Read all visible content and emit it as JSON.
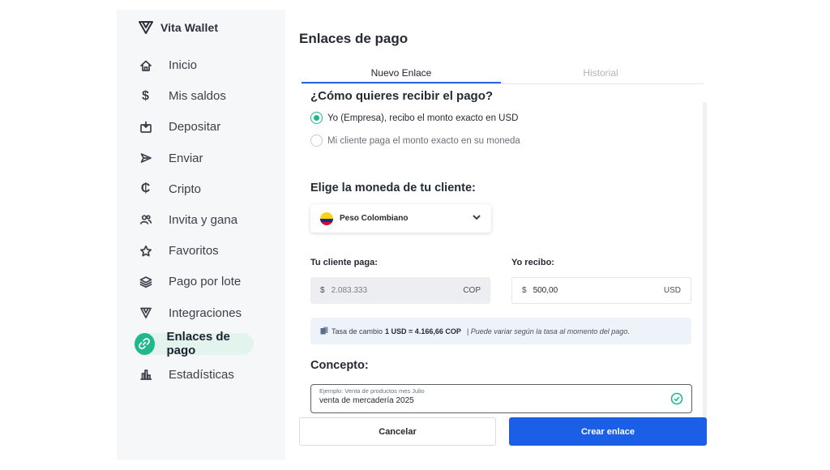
{
  "brand": {
    "name": "Vita Wallet"
  },
  "sidebar": {
    "items": [
      {
        "label": "Inicio",
        "icon": "home-icon"
      },
      {
        "label": "Mis saldos",
        "icon": "dollar-icon"
      },
      {
        "label": "Depositar",
        "icon": "deposit-icon"
      },
      {
        "label": "Enviar",
        "icon": "send-icon"
      },
      {
        "label": "Cripto",
        "icon": "crypto-icon"
      },
      {
        "label": "Invita y gana",
        "icon": "invite-icon"
      },
      {
        "label": "Favoritos",
        "icon": "star-icon"
      },
      {
        "label": "Pago por lote",
        "icon": "layers-icon"
      },
      {
        "label": "Integraciones",
        "icon": "integrations-icon"
      },
      {
        "label": "Enlaces de pago",
        "icon": "link-icon",
        "active": true
      },
      {
        "label": "Estadísticas",
        "icon": "chart-icon"
      }
    ]
  },
  "main": {
    "title": "Enlaces de pago",
    "tabs": [
      {
        "label": "Nuevo Enlace",
        "active": true
      },
      {
        "label": "Historial",
        "active": false
      }
    ],
    "question": "¿Cómo quieres recibir el pago?",
    "options": [
      {
        "label": "Yo (Empresa), recibo el monto exacto en USD",
        "checked": true
      },
      {
        "label": "Mi cliente paga el monto exacto en su moneda",
        "checked": false
      }
    ],
    "currency_title": "Elige la moneda de tu cliente:",
    "currency_selected": "Peso Colombiano",
    "client_pays_label": "Tu cliente paga:",
    "client_amount": {
      "symbol": "$",
      "value": "2.083.333",
      "currency": "COP"
    },
    "i_receive_label": "Yo recibo:",
    "my_amount": {
      "symbol": "$",
      "value": "500,00",
      "currency": "USD"
    },
    "rate": {
      "prefix": "Tasa de cambio",
      "value": "1 USD = 4.166,66 COP",
      "note": "| Puede variar según la tasa al momento del pago."
    },
    "concept_title": "Concepto:",
    "concept_placeholder": "Ejemplo: Venta de productos mes Julio",
    "concept_value": "venta de mercadería 2025",
    "cancel_label": "Cancelar",
    "create_label": "Crear enlace"
  },
  "colors": {
    "accent_green": "#1fb88c",
    "primary_blue": "#1a5fe6",
    "tab_underline": "#2b66e8"
  }
}
